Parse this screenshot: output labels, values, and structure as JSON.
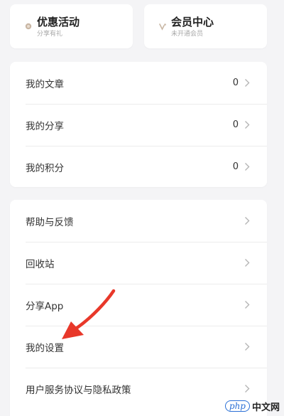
{
  "top_cards": [
    {
      "title": "优惠活动",
      "subtitle": "分享有礼",
      "icon": "coin-icon",
      "icon_color": "#c9b7a5"
    },
    {
      "title": "会员中心",
      "subtitle": "未开通会员",
      "icon": "vip-icon",
      "icon_color": "#c9b7a5"
    }
  ],
  "stats_list": [
    {
      "label": "我的文章",
      "count": "0"
    },
    {
      "label": "我的分享",
      "count": "0"
    },
    {
      "label": "我的积分",
      "count": "0"
    }
  ],
  "menu_list": [
    {
      "label": "帮助与反馈"
    },
    {
      "label": "回收站"
    },
    {
      "label": "分享App"
    },
    {
      "label": "我的设置"
    },
    {
      "label": "用户服务协议与隐私政策"
    }
  ],
  "annotation": {
    "color": "#e8382a"
  },
  "watermark": {
    "logo": "php",
    "text": "中文网"
  }
}
